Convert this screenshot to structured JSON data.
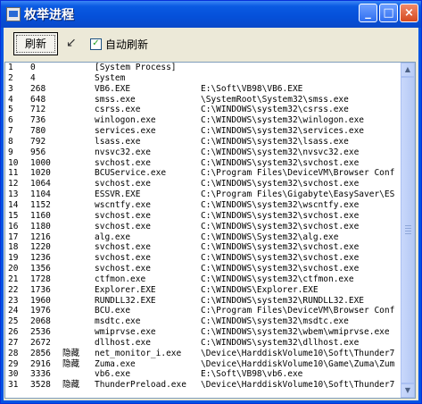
{
  "window": {
    "title": "枚举进程"
  },
  "toolbar": {
    "refresh_label": "刷新",
    "auto_refresh_label": "自动刷新",
    "auto_refresh_checked": true
  },
  "processes": [
    {
      "idx": "1",
      "pid": "0",
      "flag": "",
      "name": "[System Process]",
      "path": ""
    },
    {
      "idx": "2",
      "pid": "4",
      "flag": "",
      "name": "System",
      "path": ""
    },
    {
      "idx": "3",
      "pid": "268",
      "flag": "",
      "name": "VB6.EXE",
      "path": "E:\\Soft\\VB98\\VB6.EXE"
    },
    {
      "idx": "4",
      "pid": "648",
      "flag": "",
      "name": "smss.exe",
      "path": "\\SystemRoot\\System32\\smss.exe"
    },
    {
      "idx": "5",
      "pid": "712",
      "flag": "",
      "name": "csrss.exe",
      "path": "C:\\WINDOWS\\system32\\csrss.exe"
    },
    {
      "idx": "6",
      "pid": "736",
      "flag": "",
      "name": "winlogon.exe",
      "path": "C:\\WINDOWS\\system32\\winlogon.exe"
    },
    {
      "idx": "7",
      "pid": "780",
      "flag": "",
      "name": "services.exe",
      "path": "C:\\WINDOWS\\system32\\services.exe"
    },
    {
      "idx": "8",
      "pid": "792",
      "flag": "",
      "name": "lsass.exe",
      "path": "C:\\WINDOWS\\system32\\lsass.exe"
    },
    {
      "idx": "9",
      "pid": "956",
      "flag": "",
      "name": "nvsvc32.exe",
      "path": "C:\\WINDOWS\\system32\\nvsvc32.exe"
    },
    {
      "idx": "10",
      "pid": "1000",
      "flag": "",
      "name": "svchost.exe",
      "path": "C:\\WINDOWS\\system32\\svchost.exe"
    },
    {
      "idx": "11",
      "pid": "1020",
      "flag": "",
      "name": "BCUService.exe",
      "path": "C:\\Program Files\\DeviceVM\\Browser Conf"
    },
    {
      "idx": "12",
      "pid": "1064",
      "flag": "",
      "name": "svchost.exe",
      "path": "C:\\WINDOWS\\system32\\svchost.exe"
    },
    {
      "idx": "13",
      "pid": "1104",
      "flag": "",
      "name": "ESSVR.EXE",
      "path": "C:\\Program Files\\Gigabyte\\EasySaver\\ES"
    },
    {
      "idx": "14",
      "pid": "1152",
      "flag": "",
      "name": "wscntfy.exe",
      "path": "C:\\WINDOWS\\system32\\wscntfy.exe"
    },
    {
      "idx": "15",
      "pid": "1160",
      "flag": "",
      "name": "svchost.exe",
      "path": "C:\\WINDOWS\\system32\\svchost.exe"
    },
    {
      "idx": "16",
      "pid": "1180",
      "flag": "",
      "name": "svchost.exe",
      "path": "C:\\WINDOWS\\system32\\svchost.exe"
    },
    {
      "idx": "17",
      "pid": "1216",
      "flag": "",
      "name": "alg.exe",
      "path": "C:\\WINDOWS\\System32\\alg.exe"
    },
    {
      "idx": "18",
      "pid": "1220",
      "flag": "",
      "name": "svchost.exe",
      "path": "C:\\WINDOWS\\system32\\svchost.exe"
    },
    {
      "idx": "19",
      "pid": "1236",
      "flag": "",
      "name": "svchost.exe",
      "path": "C:\\WINDOWS\\system32\\svchost.exe"
    },
    {
      "idx": "20",
      "pid": "1356",
      "flag": "",
      "name": "svchost.exe",
      "path": "C:\\WINDOWS\\system32\\svchost.exe"
    },
    {
      "idx": "21",
      "pid": "1728",
      "flag": "",
      "name": "ctfmon.exe",
      "path": "C:\\WINDOWS\\system32\\ctfmon.exe"
    },
    {
      "idx": "22",
      "pid": "1736",
      "flag": "",
      "name": "Explorer.EXE",
      "path": "C:\\WINDOWS\\Explorer.EXE"
    },
    {
      "idx": "23",
      "pid": "1960",
      "flag": "",
      "name": "RUNDLL32.EXE",
      "path": "C:\\WINDOWS\\system32\\RUNDLL32.EXE"
    },
    {
      "idx": "24",
      "pid": "1976",
      "flag": "",
      "name": "BCU.exe",
      "path": "C:\\Program Files\\DeviceVM\\Browser Conf"
    },
    {
      "idx": "25",
      "pid": "2068",
      "flag": "",
      "name": "msdtc.exe",
      "path": "C:\\WINDOWS\\system32\\msdtc.exe"
    },
    {
      "idx": "26",
      "pid": "2536",
      "flag": "",
      "name": "wmiprvse.exe",
      "path": "C:\\WINDOWS\\system32\\wbem\\wmiprvse.exe"
    },
    {
      "idx": "27",
      "pid": "2672",
      "flag": "",
      "name": "dllhost.exe",
      "path": "C:\\WINDOWS\\system32\\dllhost.exe"
    },
    {
      "idx": "28",
      "pid": "2856",
      "flag": "隐藏",
      "name": "net_monitor_i.exe",
      "path": "\\Device\\HarddiskVolume10\\Soft\\Thunder7"
    },
    {
      "idx": "29",
      "pid": "2916",
      "flag": "隐藏",
      "name": "Zuma.exe",
      "path": "\\Device\\HarddiskVolume10\\Game\\Zuma\\Zum"
    },
    {
      "idx": "30",
      "pid": "3336",
      "flag": "",
      "name": "vb6.exe",
      "path": "E:\\Soft\\VB98\\vb6.exe"
    },
    {
      "idx": "31",
      "pid": "3528",
      "flag": "隐藏",
      "name": "ThunderPreload.exe",
      "path": "\\Device\\HarddiskVolume10\\Soft\\Thunder7"
    }
  ]
}
